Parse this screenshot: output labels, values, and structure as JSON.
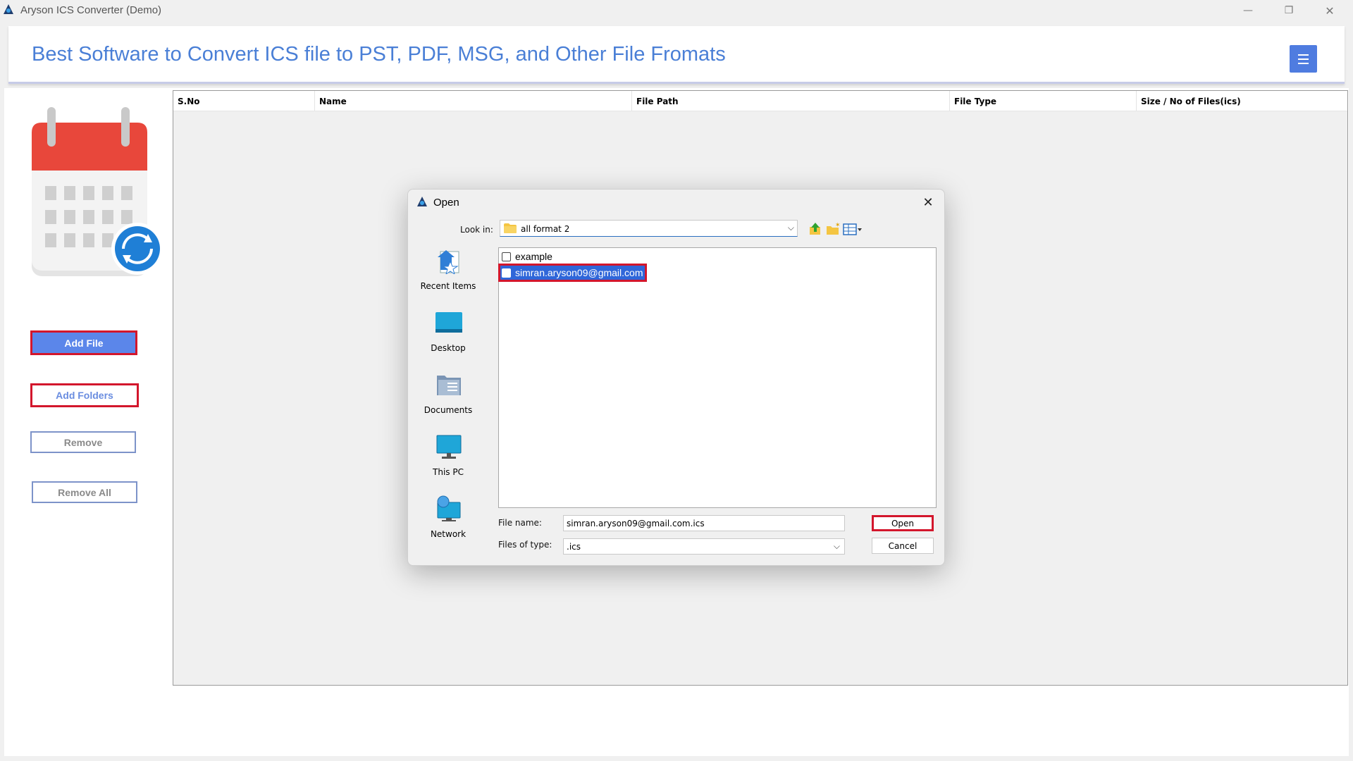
{
  "window": {
    "title": "Aryson ICS Converter (Demo)",
    "controls": {
      "minimize": "—",
      "restore": "❐",
      "close": "✕"
    }
  },
  "header": {
    "title": "Best Software to Convert ICS file to PST, PDF, MSG, and Other File Fromats",
    "menu_icon": "hamburger-icon",
    "accent_color": "#4a7fd6"
  },
  "sidebar": {
    "logo_icon": "calendar-sync-icon",
    "buttons": {
      "add_file": "Add File",
      "add_folders": "Add Folders",
      "remove": "Remove",
      "remove_all": "Remove All"
    }
  },
  "table": {
    "columns": [
      "S.No",
      "Name",
      "File Path",
      "File Type",
      "Size / No of Files(ics)"
    ],
    "rows": []
  },
  "dialog": {
    "title": "Open",
    "look_in_label": "Look in:",
    "look_in_value": "all format 2",
    "places": [
      "Recent Items",
      "Desktop",
      "Documents",
      "This PC",
      "Network"
    ],
    "files": [
      {
        "name": "example",
        "selected": false
      },
      {
        "name": "simran.aryson09@gmail.com",
        "selected": true
      }
    ],
    "file_name_label": "File name:",
    "file_name_value": "simran.aryson09@gmail.com.ics",
    "files_of_type_label": "Files of type:",
    "files_of_type_value": ".ics",
    "open_button": "Open",
    "cancel_button": "Cancel"
  }
}
